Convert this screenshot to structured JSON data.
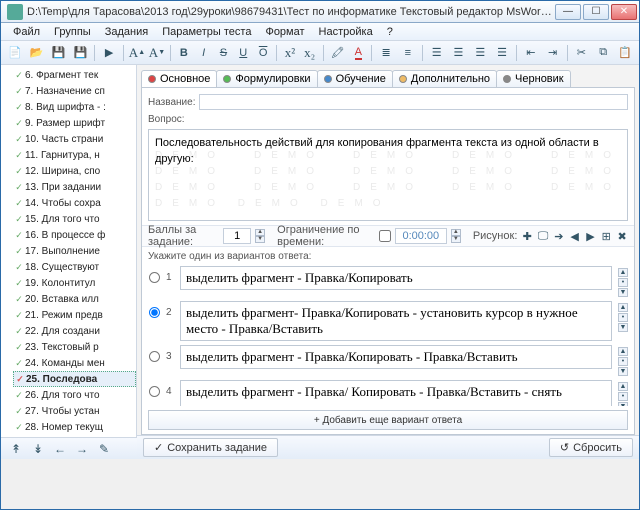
{
  "title": "D:\\Temp\\для Тарасова\\2013 год\\29уроки\\98679431\\Тест по информатике Текстовый редактор MsWord\\Текстовый  редактор Micros...",
  "menu": {
    "file": "Файл",
    "groups": "Группы",
    "tasks": "Задания",
    "params": "Параметры теста",
    "format": "Формат",
    "settings": "Настройка",
    "help": "?"
  },
  "tree": [
    "6. Фрагмент тек",
    "7. Назначение сп",
    "8. Вид шрифта - :",
    "9. Размер шрифт",
    "10. Часть страни",
    "11. Гарнитура, н",
    "12. Ширина, спо",
    "13. При задании",
    "14. Чтобы сохра",
    "15. Для того что",
    "16. В процессе ф",
    "17. Выполнение",
    "18. Существуют",
    "19. Колонтитул",
    "20. Вставка илл",
    "21. Режим предв",
    "22. Для создани",
    "23. Текстовый р",
    "24. Команды мен",
    "25. Последова",
    "26. Для того что",
    "27. Чтобы устан",
    "28. Номер текущ"
  ],
  "tree_selected": 19,
  "tabs": {
    "main": "Основное",
    "form": "Формулировки",
    "learn": "Обучение",
    "extra": "Дополнительно",
    "draft": "Черновик"
  },
  "labels": {
    "name": "Название:",
    "question": "Вопрос:",
    "points": "Баллы за задание:",
    "timelimit": "Ограничение по времени:",
    "image": "Рисунок:",
    "answers_hint": "Укажите один из вариантов ответа:"
  },
  "question_text": "Последовательность действий для копирования фрагмента текста из одной области в другую:",
  "points_value": "1",
  "time_value": "0:00:00",
  "watermark": "DEMO     DEMO     DEMO     DEMO     DEMO     DEMO     DEMO     DEMO     DEMO     DEMO     DEMO     DEMO     DEMO     DEMO     DEMO     DEMO     DEMO     DEMO",
  "answers": [
    {
      "n": "1",
      "text": "выделить фрагмент - Правка/Копировать",
      "checked": false
    },
    {
      "n": "2",
      "text": "выделить фрагмент- Правка/Копировать - установить курсор в нужное место - Правка/Вставить",
      "checked": true
    },
    {
      "n": "3",
      "text": "выделить фрагмент - Правка/Копировать - Правка/Вставить",
      "checked": false
    },
    {
      "n": "4",
      "text": "выделить фрагмент - Правка/ Копировать - Правка/Вставить - снять выделение",
      "checked": false
    },
    {
      "n": "5",
      "text": "",
      "checked": false
    }
  ],
  "buttons": {
    "add": "+  Добавить еще вариант ответа",
    "save": "Сохранить задание",
    "reset": "Сбросить"
  }
}
